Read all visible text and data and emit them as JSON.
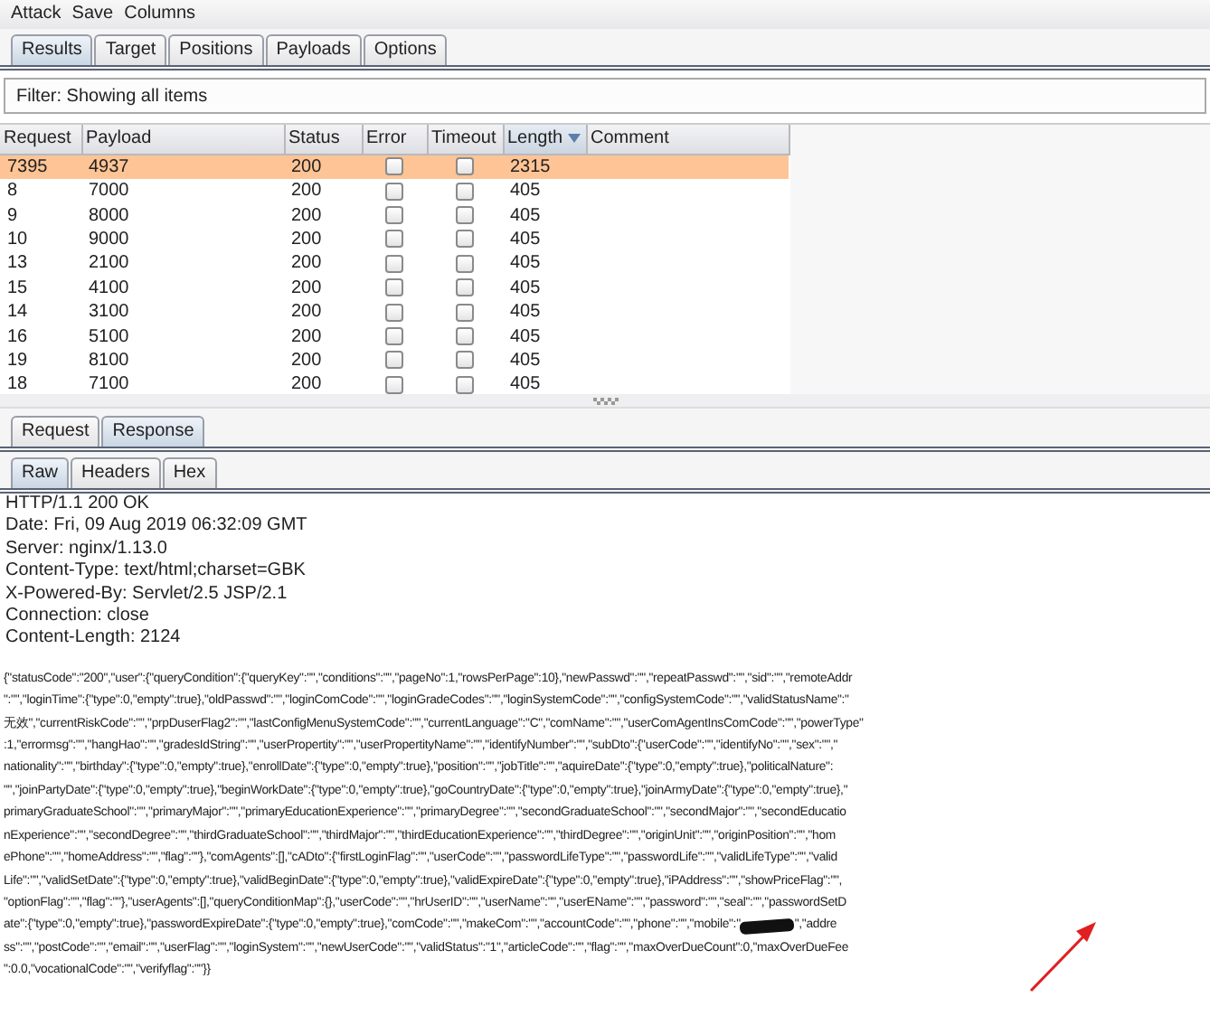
{
  "menu": [
    "Attack",
    "Save",
    "Columns"
  ],
  "tabs": [
    {
      "label": "Results",
      "selected": true
    },
    {
      "label": "Target",
      "selected": false
    },
    {
      "label": "Positions",
      "selected": false
    },
    {
      "label": "Payloads",
      "selected": false
    },
    {
      "label": "Options",
      "selected": false
    }
  ],
  "filter": "Filter: Showing all items",
  "table": {
    "columns": [
      {
        "label": "Request",
        "sorted": false
      },
      {
        "label": "Payload",
        "sorted": false
      },
      {
        "label": "Status",
        "sorted": false
      },
      {
        "label": "Error",
        "sorted": false
      },
      {
        "label": "Timeout",
        "sorted": false
      },
      {
        "label": "Length",
        "sorted": true
      },
      {
        "label": "Comment",
        "sorted": false
      }
    ],
    "rows": [
      {
        "request": "7395",
        "payload": "4937",
        "status": "200",
        "error": false,
        "timeout": false,
        "length": "2315",
        "selected": true
      },
      {
        "request": "8",
        "payload": "7000",
        "status": "200",
        "error": false,
        "timeout": false,
        "length": "405",
        "selected": false
      },
      {
        "request": "9",
        "payload": "8000",
        "status": "200",
        "error": false,
        "timeout": false,
        "length": "405",
        "selected": false
      },
      {
        "request": "10",
        "payload": "9000",
        "status": "200",
        "error": false,
        "timeout": false,
        "length": "405",
        "selected": false
      },
      {
        "request": "13",
        "payload": "2100",
        "status": "200",
        "error": false,
        "timeout": false,
        "length": "405",
        "selected": false
      },
      {
        "request": "15",
        "payload": "4100",
        "status": "200",
        "error": false,
        "timeout": false,
        "length": "405",
        "selected": false
      },
      {
        "request": "14",
        "payload": "3100",
        "status": "200",
        "error": false,
        "timeout": false,
        "length": "405",
        "selected": false
      },
      {
        "request": "16",
        "payload": "5100",
        "status": "200",
        "error": false,
        "timeout": false,
        "length": "405",
        "selected": false
      },
      {
        "request": "19",
        "payload": "8100",
        "status": "200",
        "error": false,
        "timeout": false,
        "length": "405",
        "selected": false
      },
      {
        "request": "18",
        "payload": "7100",
        "status": "200",
        "error": false,
        "timeout": false,
        "length": "405",
        "selected": false
      }
    ]
  },
  "message_tabs": [
    {
      "label": "Request",
      "selected": false
    },
    {
      "label": "Response",
      "selected": true
    }
  ],
  "view_tabs": [
    {
      "label": "Raw",
      "selected": true
    },
    {
      "label": "Headers",
      "selected": false
    },
    {
      "label": "Hex",
      "selected": false
    }
  ],
  "response_headers": [
    "HTTP/1.1 200 OK",
    "Date: Fri, 09 Aug 2019 06:32:09 GMT",
    "Server: nginx/1.13.0",
    "Content-Type: text/html;charset=GBK",
    "X-Powered-By: Servlet/2.5 JSP/2.1",
    "Connection: close",
    "Content-Length: 2124"
  ],
  "response_body": [
    [
      {
        "kind": "text",
        "text": "{\"statusCode\":\"200\",\"user\":{\"queryCondition\":{\"queryKey\":\"\",\"conditions\":\"\",\"pageNo\":1,\"rowsPerPage\":10},\"newPasswd\":\"\",\"repeatPasswd\":\"\",\"sid\":\"\",\"remoteAddr"
      }
    ],
    [
      {
        "kind": "text",
        "text": "\":\"\",\"loginTime\":{\"type\":0,\"empty\":true},\"oldPasswd\":\"\",\"loginComCode\":\"\",\"loginGradeCodes\":\"\",\"loginSystemCode\":\"\",\"configSystemCode\":\"\",\"validStatusName\":\""
      }
    ],
    [
      {
        "kind": "text",
        "text": "无效\",\"currentRiskCode\":\"\",\"prpDuserFlag2\":\"\",\"lastConfigMenuSystemCode\":\"\",\"currentLanguage\":\"C\",\"comName\":\"\",\"userComAgentInsComCode\":\"\",\"powerType\""
      }
    ],
    [
      {
        "kind": "text",
        "text": ":1,\"errormsg\":\"\",\"hangHao\":\"\",\"gradesIdString\":\"\",\"userPropertity\":\"\",\"userPropertityName\":\"\",\"identifyNumber\":\"\",\"subDto\":{\"userCode\":\"\",\"identifyNo\":\"\",\"sex\":\"\",\""
      }
    ],
    [
      {
        "kind": "text",
        "text": "nationality\":\"\",\"birthday\":{\"type\":0,\"empty\":true},\"enrollDate\":{\"type\":0,\"empty\":true},\"position\":\"\",\"jobTitle\":\"\",\"aquireDate\":{\"type\":0,\"empty\":true},\"politicalNature\":"
      }
    ],
    [
      {
        "kind": "text",
        "text": "\"\",\"joinPartyDate\":{\"type\":0,\"empty\":true},\"beginWorkDate\":{\"type\":0,\"empty\":true},\"goCountryDate\":{\"type\":0,\"empty\":true},\"joinArmyDate\":{\"type\":0,\"empty\":true},\""
      }
    ],
    [
      {
        "kind": "text",
        "text": "primaryGraduateSchool\":\"\",\"primaryMajor\":\"\",\"primaryEducationExperience\":\"\",\"primaryDegree\":\"\",\"secondGraduateSchool\":\"\",\"secondMajor\":\"\",\"secondEducatio"
      }
    ],
    [
      {
        "kind": "text",
        "text": "nExperience\":\"\",\"secondDegree\":\"\",\"thirdGraduateSchool\":\"\",\"thirdMajor\":\"\",\"thirdEducationExperience\":\"\",\"thirdDegree\":\"\",\"originUnit\":\"\",\"originPosition\":\"\",\"hom"
      }
    ],
    [
      {
        "kind": "text",
        "text": "ePhone\":\"\",\"homeAddress\":\"\",\"flag\":\"\"},\"comAgents\":[],\"cADto\":{\"firstLoginFlag\":\"\",\"userCode\":\"\",\"passwordLifeType\":\"\",\"passwordLife\":\"\",\"validLifeType\":\"\",\"valid"
      }
    ],
    [
      {
        "kind": "text",
        "text": "Life\":\"\",\"validSetDate\":{\"type\":0,\"empty\":true},\"validBeginDate\":{\"type\":0,\"empty\":true},\"validExpireDate\":{\"type\":0,\"empty\":true},\"iPAddress\":\"\",\"showPriceFlag\":\"\","
      }
    ],
    [
      {
        "kind": "text",
        "text": "\"optionFlag\":\"\",\"flag\":\"\"},\"userAgents\":[],\"queryConditionMap\":{},\"userCode\":\"\",\"hrUserID\":\"\",\"userName\":\"\",\"userEName\":\"\",\"password\":\"\",\"seal\":\"\",\"passwordSetD"
      }
    ],
    [
      {
        "kind": "text",
        "text": "ate\":{\"type\":0,\"empty\":true},\"passwordExpireDate\":{\"type\":0,\"empty\":true},\"comCode\":\"\",\"makeCom\":\"\",\"accountCode\":\"\",\"phone\":\"\",\"mobile\":\""
      },
      {
        "kind": "redaction"
      },
      {
        "kind": "text",
        "text": "\",\"addre"
      }
    ],
    [
      {
        "kind": "text",
        "text": "ss\":\"\",\"postCode\":\"\",\"email\":\"\",\"userFlag\":\"\",\"loginSystem\":\"\",\"newUserCode\":\"\",\"validStatus\":\"1\",\"articleCode\":\"\",\"flag\":\"\",\"maxOverDueCount\":0,\"maxOverDueFee"
      }
    ],
    [
      {
        "kind": "text",
        "text": "\":0.0,\"vocationalCode\":\"\",\"verifyflag\":\"\"}}"
      }
    ]
  ],
  "annotation": {
    "kind": "arrow"
  }
}
